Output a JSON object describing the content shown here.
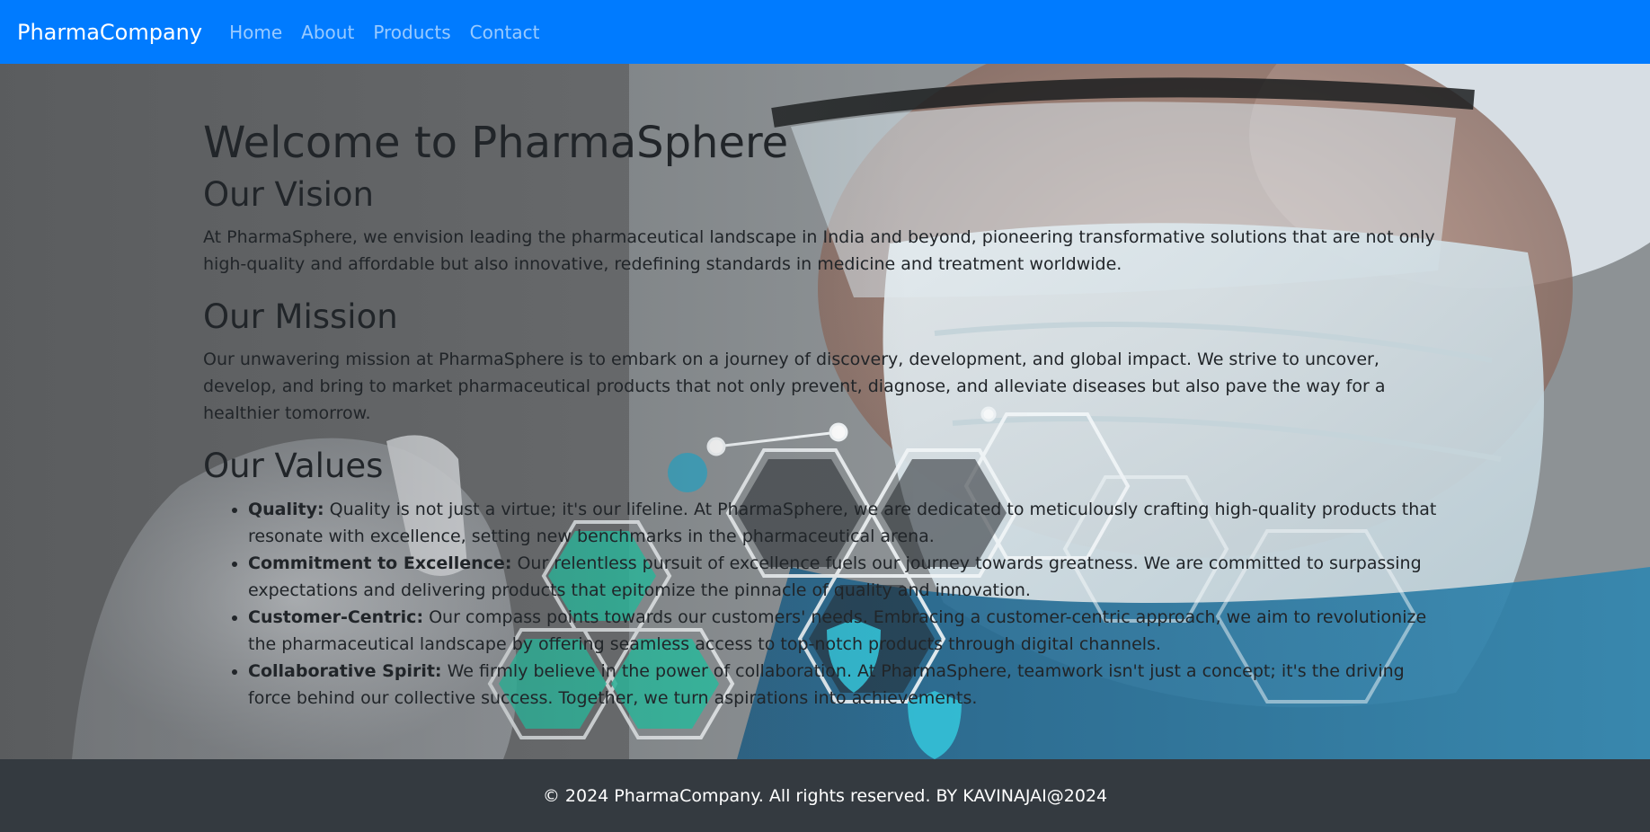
{
  "navbar": {
    "brand": "PharmaCompany",
    "links": [
      "Home",
      "About",
      "Products",
      "Contact"
    ],
    "background_color": "#007bff"
  },
  "hero": {
    "title": "Welcome to PharmaSphere",
    "vision": {
      "heading": "Our Vision",
      "text": "At PharmaSphere, we envision leading the pharmaceutical landscape in India and beyond, pioneering transformative solutions that are not only high-quality and affordable but also innovative, redefining standards in medicine and treatment worldwide."
    },
    "mission": {
      "heading": "Our Mission",
      "text": "Our unwavering mission at PharmaSphere is to embark on a journey of discovery, development, and global impact. We strive to uncover, develop, and bring to market pharmaceutical products that not only prevent, diagnose, and alleviate diseases but also pave the way for a healthier tomorrow."
    },
    "values": {
      "heading": "Our Values",
      "items": [
        {
          "label": "Quality:",
          "text": " Quality is not just a virtue; it's our lifeline. At PharmaSphere, we are dedicated to meticulously crafting high-quality products that resonate with excellence, setting new benchmarks in the pharmaceutical arena."
        },
        {
          "label": "Commitment to Excellence:",
          "text": " Our relentless pursuit of excellence fuels our journey towards greatness. We are committed to surpassing expectations and delivering products that epitomize the pinnacle of quality and innovation."
        },
        {
          "label": "Customer-Centric:",
          "text": " Our compass points towards our customers' needs. Embracing a customer-centric approach, we aim to revolutionize the pharmaceutical landscape by offering seamless access to top-notch products through digital channels."
        },
        {
          "label": "Collaborative Spirit:",
          "text": " We firmly believe in the power of collaboration. At PharmaSphere, teamwork isn't just a concept; it's the driving force behind our collective success. Together, we turn aspirations into achievements."
        }
      ]
    }
  },
  "footer": {
    "text": "© 2024 PharmaCompany. All rights reserved. BY KAVINAJAI@2024",
    "background_color": "#343a40"
  }
}
